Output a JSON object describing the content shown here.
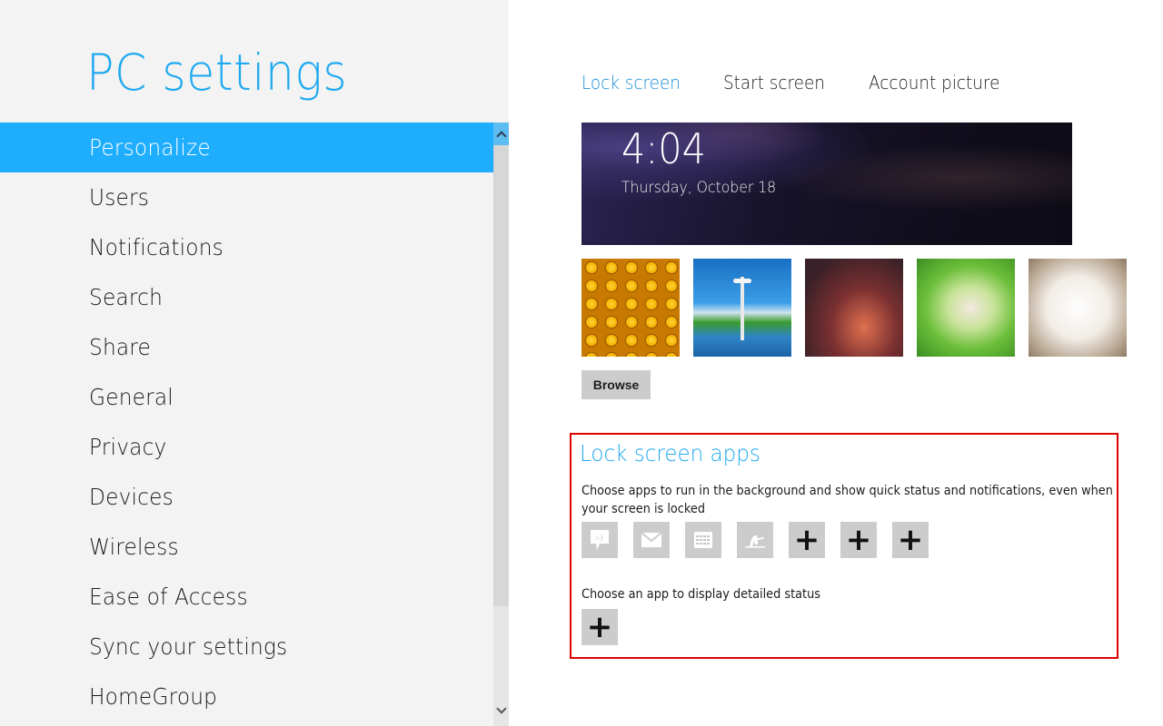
{
  "sidebar": {
    "title": "PC settings",
    "items": [
      {
        "label": "Personalize",
        "selected": true
      },
      {
        "label": "Users",
        "selected": false
      },
      {
        "label": "Notifications",
        "selected": false
      },
      {
        "label": "Search",
        "selected": false
      },
      {
        "label": "Share",
        "selected": false
      },
      {
        "label": "General",
        "selected": false
      },
      {
        "label": "Privacy",
        "selected": false
      },
      {
        "label": "Devices",
        "selected": false
      },
      {
        "label": "Wireless",
        "selected": false
      },
      {
        "label": "Ease of Access",
        "selected": false
      },
      {
        "label": "Sync your settings",
        "selected": false
      },
      {
        "label": "HomeGroup",
        "selected": false
      }
    ],
    "scrollbar": {
      "up_icon": "chevron-up-icon",
      "down_icon": "chevron-down-icon"
    }
  },
  "main": {
    "tabs": [
      {
        "label": "Lock screen",
        "active": true
      },
      {
        "label": "Start screen",
        "active": false
      },
      {
        "label": "Account picture",
        "active": false
      }
    ],
    "lock_preview": {
      "time": "4:04",
      "date": "Thursday, October 18"
    },
    "thumbnails": [
      {
        "name": "honeycomb"
      },
      {
        "name": "space-needle"
      },
      {
        "name": "anime-group"
      },
      {
        "name": "anime-girl-forest"
      },
      {
        "name": "anime-two-girls"
      }
    ],
    "browse_label": "Browse",
    "lock_screen_apps": {
      "title": "Lock screen apps",
      "description": "Choose apps to run in the background and show quick status and notifications, even when your screen is locked",
      "apps": [
        {
          "icon": "messaging-icon",
          "label": ""
        },
        {
          "icon": "mail-icon",
          "label": ""
        },
        {
          "icon": "calendar-icon",
          "label": ""
        },
        {
          "icon": "snowboarder-app-icon",
          "label": ""
        },
        {
          "icon": "plus-icon",
          "label": "+"
        },
        {
          "icon": "plus-icon",
          "label": "+"
        },
        {
          "icon": "plus-icon",
          "label": "+"
        }
      ],
      "detailed_status_label": "Choose an app to display detailed status",
      "detailed_status_add": "+"
    },
    "colors": {
      "accent": "#1fadfe",
      "title_blue": "#1fa9f0",
      "active_tab": "#1a8fd6",
      "highlight_border": "#e00000",
      "tile_gray": "#cccccc"
    }
  }
}
